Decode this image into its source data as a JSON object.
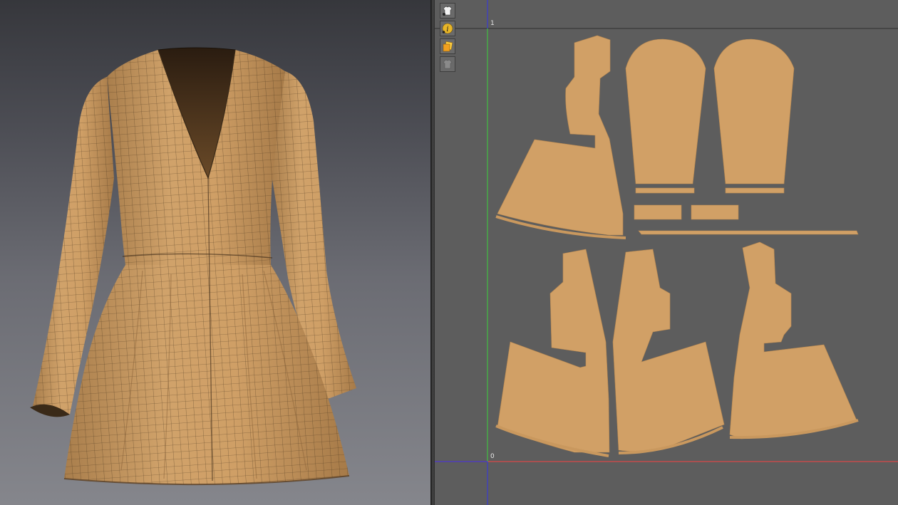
{
  "viewport_3d": {
    "background_top": "#36373c",
    "background_bottom": "#85868c",
    "garment_color": "#c69a64",
    "mesh_line_color": "#3a2a18"
  },
  "viewport_2d": {
    "background": "#5d5d5d",
    "pattern_fill": "#d1a066",
    "x_axis_color": "#d94848",
    "y_axis_color": "#40c040",
    "origin_axis_color": "#3b3bd0",
    "axis_labels": {
      "top": "1",
      "bottom": "0"
    }
  },
  "toolbar": {
    "tools": [
      {
        "icon": "avatar-display-icon"
      },
      {
        "icon": "info-icon"
      },
      {
        "icon": "texture-icon"
      },
      {
        "icon": "garment-display-icon"
      }
    ]
  }
}
